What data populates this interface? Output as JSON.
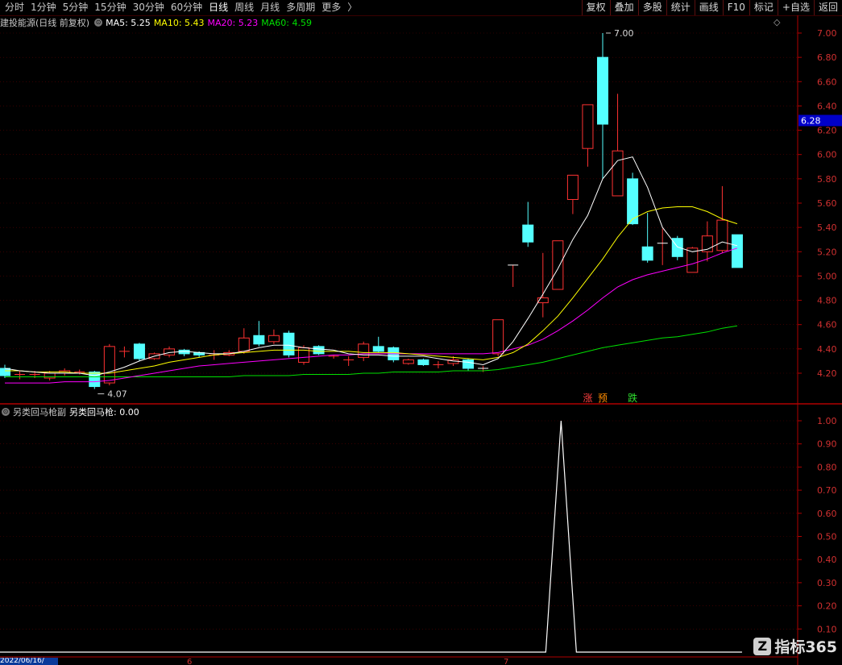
{
  "toolbar": {
    "periods": [
      "分时",
      "1分钟",
      "5分钟",
      "15分钟",
      "30分钟",
      "60分钟",
      "日线",
      "周线",
      "月线",
      "多周期",
      "更多"
    ],
    "active_period": "日线",
    "more_arrow": "〉",
    "right_buttons": [
      "复权",
      "叠加",
      "多股",
      "统计",
      "画线",
      "F10",
      "标记",
      "+自选",
      "返回"
    ]
  },
  "main_info": {
    "stock": "建投能源(日线 前复权)",
    "ma5_label": "MA5: 5.25",
    "ma10_label": "MA10: 5.43",
    "ma20_label": "MA20: 5.23",
    "ma60_label": "MA60: 4.59",
    "diamond": "◇"
  },
  "sub_info": {
    "indicator": "另类回马枪副",
    "value_label": "另类回马枪: 0.00"
  },
  "colors": {
    "up": "#ff3232",
    "down": "#54ffff",
    "ma5": "#ffffff",
    "ma10": "#ffff00",
    "ma20": "#ff00ff",
    "ma60": "#00e000",
    "axis": "#b00000",
    "grid": "#5a0000",
    "current_price_bg": "#0000c8"
  },
  "price_axis": {
    "ticks": [
      "7.00",
      "6.80",
      "6.60",
      "6.40",
      "6.20",
      "6.00",
      "5.80",
      "5.60",
      "5.40",
      "5.20",
      "5.00",
      "4.80",
      "4.60",
      "4.40",
      "4.20"
    ],
    "current_price": "6.28",
    "max_label": "7.00",
    "min_label": "4.07"
  },
  "sub_axis": {
    "ticks": [
      "1.00",
      "0.90",
      "0.80",
      "0.70",
      "0.60",
      "0.50",
      "0.40",
      "0.30",
      "0.20",
      "0.10"
    ]
  },
  "markers": {
    "zhang": "涨",
    "yu": "预",
    "die": "跌"
  },
  "bottom": {
    "date": "2022/06/16/",
    "month_6": "6",
    "month_7": "7"
  },
  "watermark": {
    "icon": "Z",
    "text": "指标365"
  },
  "chart_data": {
    "type": "candlestick",
    "price_range": [
      4.0,
      7.1
    ],
    "sub_range": [
      0,
      1.05
    ],
    "candles": [
      {
        "o": 4.24,
        "c": 4.18,
        "h": 4.27,
        "l": 4.16
      },
      {
        "o": 4.19,
        "c": 4.19,
        "h": 4.22,
        "l": 4.15
      },
      {
        "o": 4.19,
        "c": 4.19,
        "h": 4.22,
        "l": 4.16
      },
      {
        "o": 4.16,
        "c": 4.2,
        "h": 4.22,
        "l": 4.14
      },
      {
        "o": 4.2,
        "c": 4.22,
        "h": 4.24,
        "l": 4.18
      },
      {
        "o": 4.21,
        "c": 4.21,
        "h": 4.23,
        "l": 4.19
      },
      {
        "o": 4.21,
        "c": 4.09,
        "h": 4.22,
        "l": 4.07
      },
      {
        "o": 4.12,
        "c": 4.42,
        "h": 4.44,
        "l": 4.1
      },
      {
        "o": 4.38,
        "c": 4.38,
        "h": 4.42,
        "l": 4.33
      },
      {
        "o": 4.44,
        "c": 4.32,
        "h": 4.45,
        "l": 4.3
      },
      {
        "o": 4.32,
        "c": 4.36,
        "h": 4.37,
        "l": 4.31
      },
      {
        "o": 4.35,
        "c": 4.4,
        "h": 4.42,
        "l": 4.33
      },
      {
        "o": 4.39,
        "c": 4.36,
        "h": 4.4,
        "l": 4.34
      },
      {
        "o": 4.37,
        "c": 4.35,
        "h": 4.38,
        "l": 4.33
      },
      {
        "o": 4.35,
        "c": 4.35,
        "h": 4.39,
        "l": 4.31
      },
      {
        "o": 4.35,
        "c": 4.37,
        "h": 4.39,
        "l": 4.34
      },
      {
        "o": 4.38,
        "c": 4.49,
        "h": 4.57,
        "l": 4.36
      },
      {
        "o": 4.51,
        "c": 4.44,
        "h": 4.63,
        "l": 4.42
      },
      {
        "o": 4.46,
        "c": 4.51,
        "h": 4.56,
        "l": 4.44
      },
      {
        "o": 4.53,
        "c": 4.35,
        "h": 4.55,
        "l": 4.33
      },
      {
        "o": 4.29,
        "c": 4.41,
        "h": 4.43,
        "l": 4.27
      },
      {
        "o": 4.42,
        "c": 4.36,
        "h": 4.43,
        "l": 4.35
      },
      {
        "o": 4.34,
        "c": 4.34,
        "h": 4.35,
        "l": 4.32
      },
      {
        "o": 4.31,
        "c": 4.31,
        "h": 4.34,
        "l": 4.26
      },
      {
        "o": 4.33,
        "c": 4.44,
        "h": 4.46,
        "l": 4.3
      },
      {
        "o": 4.42,
        "c": 4.38,
        "h": 4.5,
        "l": 4.37
      },
      {
        "o": 4.41,
        "c": 4.31,
        "h": 4.42,
        "l": 4.29
      },
      {
        "o": 4.28,
        "c": 4.31,
        "h": 4.32,
        "l": 4.27
      },
      {
        "o": 4.31,
        "c": 4.27,
        "h": 4.32,
        "l": 4.26
      },
      {
        "o": 4.27,
        "c": 4.27,
        "h": 4.3,
        "l": 4.24
      },
      {
        "o": 4.28,
        "c": 4.31,
        "h": 4.34,
        "l": 4.26
      },
      {
        "o": 4.31,
        "c": 4.24,
        "h": 4.32,
        "l": 4.22
      },
      {
        "o": 4.24,
        "c": 4.24,
        "h": 4.26,
        "l": 4.21
      },
      {
        "o": 4.36,
        "c": 4.64,
        "h": 4.64,
        "l": 4.34
      },
      {
        "o": 5.09,
        "c": 5.09,
        "h": 5.09,
        "l": 4.91
      },
      {
        "o": 5.42,
        "c": 5.28,
        "h": 5.61,
        "l": 5.24
      },
      {
        "o": 4.78,
        "c": 4.82,
        "h": 5.19,
        "l": 4.66
      },
      {
        "o": 4.89,
        "c": 5.29,
        "h": 5.29,
        "l": 4.89
      },
      {
        "o": 5.63,
        "c": 5.83,
        "h": 5.83,
        "l": 5.51
      },
      {
        "o": 6.05,
        "c": 6.41,
        "h": 6.41,
        "l": 5.9
      },
      {
        "o": 6.8,
        "c": 6.25,
        "h": 7.0,
        "l": 5.8
      },
      {
        "o": 5.66,
        "c": 6.03,
        "h": 6.5,
        "l": 5.66
      },
      {
        "o": 5.8,
        "c": 5.43,
        "h": 5.85,
        "l": 5.42
      },
      {
        "o": 5.24,
        "c": 5.13,
        "h": 5.52,
        "l": 5.11
      },
      {
        "o": 5.27,
        "c": 5.27,
        "h": 5.39,
        "l": 5.09
      },
      {
        "o": 5.31,
        "c": 5.16,
        "h": 5.33,
        "l": 5.13
      },
      {
        "o": 5.03,
        "c": 5.23,
        "h": 5.24,
        "l": 5.03
      },
      {
        "o": 5.2,
        "c": 5.33,
        "h": 5.45,
        "l": 5.12
      },
      {
        "o": 5.21,
        "c": 5.46,
        "h": 5.74,
        "l": 5.19
      },
      {
        "o": 5.34,
        "c": 5.07,
        "h": 5.34,
        "l": 5.07
      }
    ],
    "ma5": [
      4.24,
      4.22,
      4.21,
      4.2,
      4.2,
      4.2,
      4.18,
      4.21,
      4.25,
      4.3,
      4.34,
      4.37,
      4.38,
      4.37,
      4.36,
      4.36,
      4.38,
      4.41,
      4.43,
      4.43,
      4.41,
      4.4,
      4.39,
      4.36,
      4.35,
      4.35,
      4.34,
      4.34,
      4.34,
      4.32,
      4.3,
      4.29,
      4.27,
      4.32,
      4.46,
      4.65,
      4.85,
      5.06,
      5.3,
      5.5,
      5.8,
      5.95,
      5.98,
      5.73,
      5.4,
      5.24,
      5.2,
      5.22,
      5.28,
      5.25
    ],
    "ma10": [
      4.22,
      4.22,
      4.21,
      4.21,
      4.21,
      4.2,
      4.2,
      4.2,
      4.22,
      4.24,
      4.26,
      4.29,
      4.31,
      4.33,
      4.35,
      4.36,
      4.37,
      4.38,
      4.39,
      4.39,
      4.39,
      4.38,
      4.38,
      4.38,
      4.37,
      4.37,
      4.37,
      4.36,
      4.35,
      4.34,
      4.33,
      4.32,
      4.31,
      4.33,
      4.37,
      4.44,
      4.55,
      4.67,
      4.82,
      4.98,
      5.14,
      5.32,
      5.47,
      5.53,
      5.56,
      5.57,
      5.57,
      5.53,
      5.47,
      5.43
    ],
    "ma20": [
      4.12,
      4.12,
      4.12,
      4.12,
      4.13,
      4.13,
      4.13,
      4.14,
      4.16,
      4.18,
      4.2,
      4.22,
      4.24,
      4.26,
      4.27,
      4.28,
      4.29,
      4.3,
      4.31,
      4.32,
      4.33,
      4.34,
      4.35,
      4.35,
      4.36,
      4.36,
      4.36,
      4.36,
      4.36,
      4.36,
      4.36,
      4.36,
      4.36,
      4.37,
      4.4,
      4.43,
      4.48,
      4.55,
      4.63,
      4.72,
      4.82,
      4.91,
      4.97,
      5.01,
      5.04,
      5.07,
      5.1,
      5.14,
      5.19,
      5.23
    ],
    "ma60": [
      4.17,
      4.17,
      4.17,
      4.17,
      4.17,
      4.17,
      4.17,
      4.17,
      4.17,
      4.17,
      4.17,
      4.17,
      4.17,
      4.17,
      4.17,
      4.17,
      4.18,
      4.18,
      4.18,
      4.18,
      4.19,
      4.19,
      4.19,
      4.19,
      4.2,
      4.2,
      4.21,
      4.21,
      4.21,
      4.21,
      4.22,
      4.22,
      4.22,
      4.23,
      4.25,
      4.27,
      4.29,
      4.32,
      4.35,
      4.38,
      4.41,
      4.43,
      4.45,
      4.47,
      4.49,
      4.5,
      4.52,
      4.54,
      4.57,
      4.59
    ],
    "indicator_spike_index": 37,
    "indicator_spike_value": 1.0,
    "marker_indices": {
      "zhang": 39,
      "yu": 40,
      "die": 42
    }
  }
}
